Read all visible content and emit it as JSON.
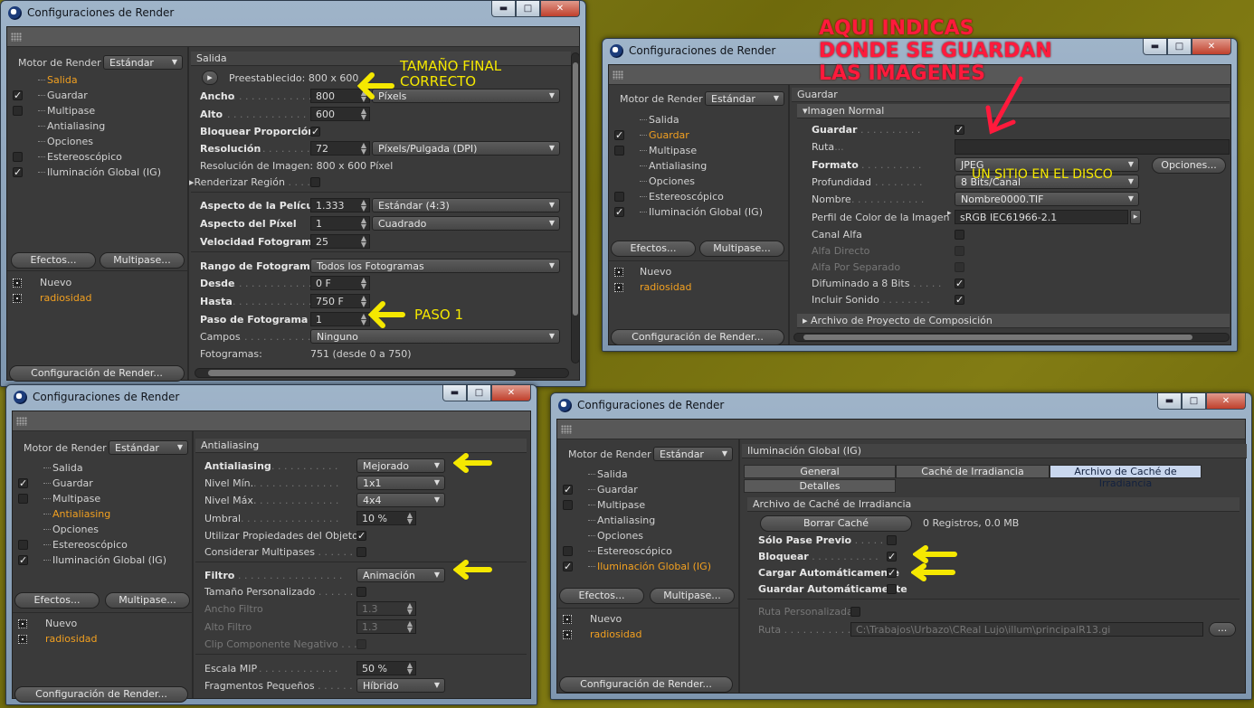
{
  "window_title": "Configuraciones de Render",
  "common": {
    "engine_label": "Motor de Render",
    "engine_value": "Estándar",
    "tree": [
      "Salida",
      "Guardar",
      "Multipase",
      "Antialiasing",
      "Opciones",
      "Estereoscópico",
      "Iluminación Global (IG)"
    ],
    "effects_btn": "Efectos...",
    "multipass_btn": "Multipase...",
    "settings": [
      "Nuevo",
      "radiosidad"
    ],
    "config_btn": "Configuración de Render..."
  },
  "w1": {
    "section": "Salida",
    "preset_label": "Preestablecido: 800 x 600",
    "ancho_label": "Ancho",
    "ancho_value": "800",
    "ancho_unit": "Píxels",
    "alto_label": "Alto",
    "alto_value": "600",
    "bloquear_label": "Bloquear Proporción",
    "res_label": "Resolución",
    "res_value": "72",
    "res_unit": "Píxels/Pulgada (DPI)",
    "res_img": "Resolución de Imagen: 800 x 600 Píxel",
    "render_region": "Renderizar Región",
    "aspecto_pel_label": "Aspecto de la Película",
    "aspecto_pel_value": "1.333",
    "aspecto_pel_preset": "Estándar (4:3)",
    "aspecto_pix_label": "Aspecto del Píxel",
    "aspecto_pix_value": "1",
    "aspecto_pix_preset": "Cuadrado",
    "vel_label": "Velocidad Fotogramas",
    "vel_value": "25",
    "rango_label": "Rango de Fotogramas",
    "rango_value": "Todos los Fotogramas",
    "desde_label": "Desde",
    "desde_value": "0 F",
    "hasta_label": "Hasta",
    "hasta_value": "750 F",
    "paso_label": "Paso de Fotograma",
    "paso_value": "1",
    "campos_label": "Campos",
    "campos_value": "Ninguno",
    "fotogramas_label": "Fotogramas:",
    "fotogramas_value": "751 (desde 0 a 750)",
    "ann_size": [
      "TAMAÑO FINAL",
      "CORRECTO"
    ],
    "ann_paso": "PASO 1"
  },
  "w2": {
    "section": "Guardar",
    "subsection": "Imagen Normal",
    "guardar_label": "Guardar",
    "ruta_label": "Ruta",
    "formato_label": "Formato",
    "formato_value": "JPEG",
    "opciones_btn": "Opciones...",
    "prof_label": "Profundidad",
    "prof_value": "8 Bits/Canal",
    "nombre_label": "Nombre",
    "nombre_value": "Nombre0000.TIF",
    "perfil_label": "Perfil de Color de la Imagen",
    "perfil_value": "sRGB IEC61966-2.1",
    "canal_alfa": "Canal Alfa",
    "alfa_directo": "Alfa Directo",
    "alfa_sep": "Alfa Por Separado",
    "difuminado": "Difuminado a 8 Bits",
    "sonido": "Incluir Sonido",
    "archivo_proyecto": "Archivo de Proyecto de Composición",
    "ann_title": [
      "AQUI INDICAS",
      "DONDE SE GUARDAN",
      "LAS IMAGENES"
    ],
    "ann_disk": "UN SITIO EN EL DISCO"
  },
  "w3": {
    "section": "Antialiasing",
    "aa_label": "Antialiasing",
    "aa_value": "Mejorado",
    "nmin_label": "Nivel Mín.",
    "nmin_value": "1x1",
    "nmax_label": "Nivel Máx.",
    "nmax_value": "4x4",
    "umbral_label": "Umbral",
    "umbral_value": "10 %",
    "usar_prop": "Utilizar Propiedades del Objeto",
    "considerar": "Considerar Multipases",
    "filtro_label": "Filtro",
    "filtro_value": "Animación",
    "tam_pers": "Tamaño Personalizado",
    "ancho_filtro_label": "Ancho Filtro",
    "ancho_filtro_value": "1.3",
    "alto_filtro_label": "Alto Filtro",
    "alto_filtro_value": "1.3",
    "clip_neg": "Clip Componente Negativo",
    "mip_label": "Escala MIP",
    "mip_value": "50 %",
    "frag_label": "Fragmentos Pequeños",
    "frag_value": "Híbrido"
  },
  "w4": {
    "section": "Iluminación Global (IG)",
    "tabs": [
      "General",
      "Caché de Irradiancia",
      "Archivo de Caché de Irradiancia",
      "Detalles"
    ],
    "subsection": "Archivo de Caché de Irradiancia",
    "borrar_btn": "Borrar Caché",
    "registros": "0 Registros, 0.0 MB",
    "solo_pase": "Sólo Pase Previo",
    "bloquear": "Bloquear",
    "cargar_auto": "Cargar Automáticamente",
    "guardar_auto": "Guardar Automáticamente",
    "ruta_pers": "Ruta Personalizada",
    "ruta_label": "Ruta",
    "ruta_value": "C:\\Trabajos\\Urbazo\\CReal Lujo\\illum\\principalR13.gi",
    "dots_btn": "..."
  },
  "colors": {
    "accent": "#f2a020",
    "annotation_yellow": "#f5e800",
    "annotation_red": "#ff1a3c"
  }
}
